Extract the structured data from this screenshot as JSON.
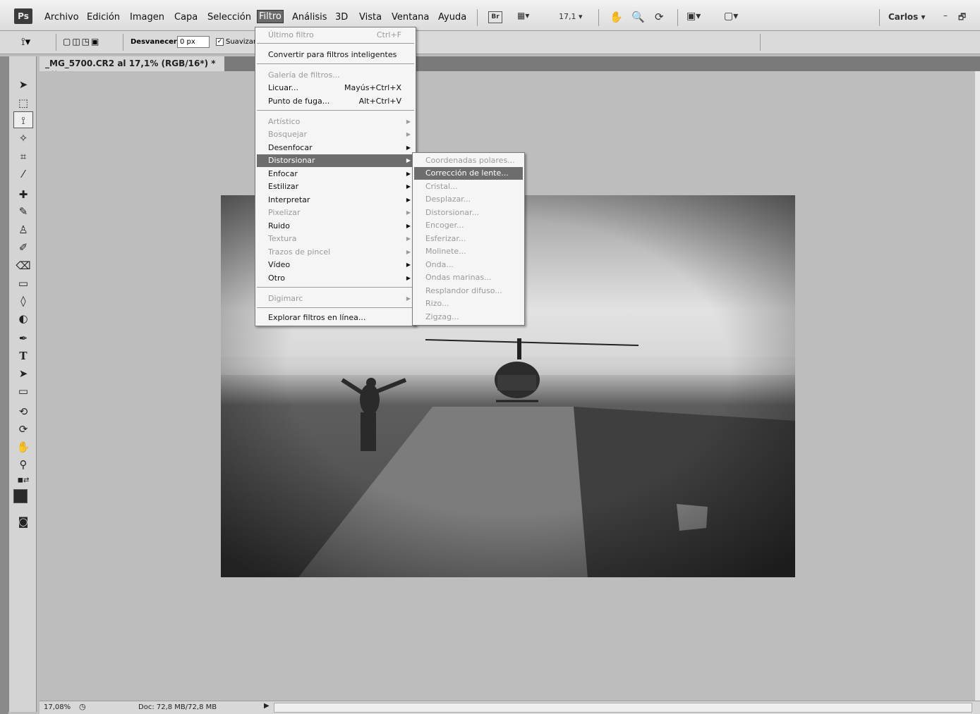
{
  "app": {
    "logo": "Ps"
  },
  "menubar": {
    "items": [
      "Archivo",
      "Edición",
      "Imagen",
      "Capa",
      "Selección",
      "Filtro",
      "Análisis",
      "3D",
      "Vista",
      "Ventana",
      "Ayuda"
    ],
    "bridge": "Br",
    "zoom": "17,1",
    "user": "Carlos"
  },
  "options": {
    "feather_label": "Desvanecer:",
    "feather_value": "0 px",
    "smooth_label": "Suavizar"
  },
  "document": {
    "tab_title": "_MG_5700.CR2 al 17,1% (RGB/16*) *",
    "close": "×"
  },
  "status": {
    "zoom": "17,08%",
    "doc_size": "Doc: 72,8 MB/72,8 MB"
  },
  "filter_menu": {
    "last_filter": {
      "label": "Último filtro",
      "shortcut": "Ctrl+F"
    },
    "smart_filters": "Convertir para filtros inteligentes",
    "gallery": "Galería de filtros...",
    "liquify": {
      "label": "Licuar...",
      "shortcut": "Mayús+Ctrl+X"
    },
    "vanishing": {
      "label": "Punto de fuga...",
      "shortcut": "Alt+Ctrl+V"
    },
    "groups": [
      "Artístico",
      "Bosquejar",
      "Desenfocar",
      "Distorsionar",
      "Enfocar",
      "Estilizar",
      "Interpretar",
      "Pixelizar",
      "Ruido",
      "Textura",
      "Trazos de pincel",
      "Vídeo",
      "Otro"
    ],
    "digimarc": "Digimarc",
    "browse": "Explorar filtros en línea..."
  },
  "distort_menu": {
    "items": [
      "Coordenadas polares...",
      "Corrección de lente...",
      "Cristal...",
      "Desplazar...",
      "Distorsionar...",
      "Encoger...",
      "Esferizar...",
      "Molinete...",
      "Onda...",
      "Ondas marinas...",
      "Resplandor difuso...",
      "Rizo...",
      "Zigzag..."
    ]
  }
}
